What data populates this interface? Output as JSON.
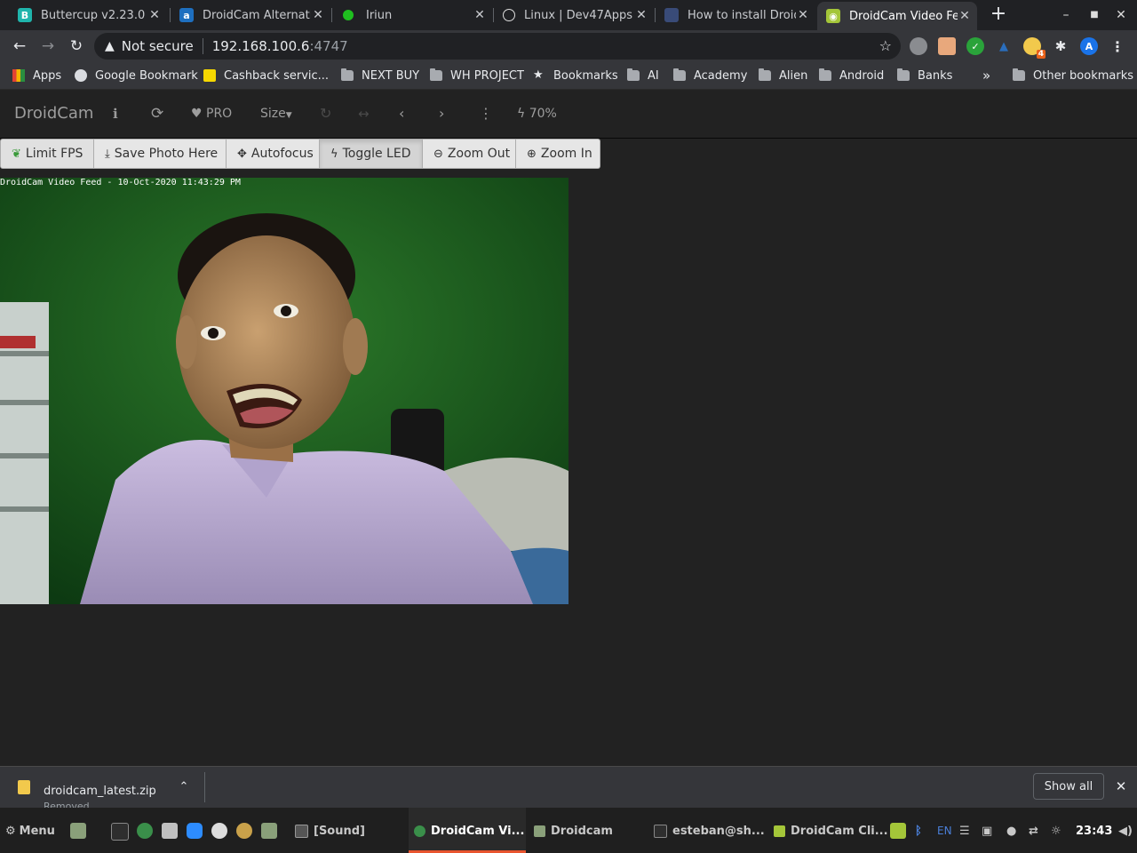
{
  "browser": {
    "tabs": [
      {
        "title": "Buttercup v2.23.0",
        "icon": "buttercup-icon",
        "color": "#1fb5ac"
      },
      {
        "title": "DroidCam Alternati",
        "icon": "alternativeto-icon",
        "color": "#1e6fbf"
      },
      {
        "title": "Iriun",
        "icon": "iriun-dot-icon",
        "color": "#1fbf1f"
      },
      {
        "title": "Linux | Dev47Apps",
        "icon": "dev47apps-icon",
        "color": "#dddddd"
      },
      {
        "title": "How to install Droid",
        "icon": "howto-icon",
        "color": "#394b78"
      },
      {
        "title": "DroidCam Video Fe",
        "icon": "droidcam-icon",
        "color": "#a4c639"
      }
    ],
    "new_tab": "+",
    "address": {
      "security": "Not secure",
      "host": "192.168.100.6",
      "port": ":4747"
    },
    "bookmarks": [
      {
        "label": "Apps",
        "icon": "apps-grid-icon"
      },
      {
        "label": "Google Bookmark",
        "icon": "globe-icon"
      },
      {
        "label": "Cashback servic...",
        "icon": "cashback-icon"
      },
      {
        "label": "NEXT BUY",
        "icon": "folder-icon"
      },
      {
        "label": "WH PROJECT",
        "icon": "folder-icon"
      },
      {
        "label": "Bookmarks",
        "icon": "star-icon"
      },
      {
        "label": "AI",
        "icon": "folder-icon"
      },
      {
        "label": "Academy",
        "icon": "folder-icon"
      },
      {
        "label": "Alien",
        "icon": "folder-icon"
      },
      {
        "label": "Android",
        "icon": "folder-icon"
      },
      {
        "label": "Banks",
        "icon": "folder-icon"
      }
    ],
    "bookmarks_overflow": "»",
    "other_bookmarks": "Other bookmarks",
    "profile_initial": "A",
    "extension_badge": "4"
  },
  "droidcam": {
    "brand": "DroidCam",
    "pro": "PRO",
    "size": "Size",
    "battery": "70%",
    "buttons": {
      "limit_fps": "Limit FPS",
      "save_photo": "Save Photo Here",
      "autofocus": "Autofocus",
      "toggle_led": "Toggle LED",
      "zoom_out": "Zoom Out",
      "zoom_in": "Zoom In"
    },
    "video_caption": "DroidCam Video Feed - 10-Oct-2020 11:43:29 PM"
  },
  "download": {
    "filename": "droidcam_latest.zip",
    "status": "Removed",
    "show_all": "Show all"
  },
  "taskbar": {
    "menu": "Menu",
    "windows": [
      {
        "label": "[Sound]"
      },
      {
        "label": "DroidCam Vi..."
      },
      {
        "label": "Droidcam"
      },
      {
        "label": "esteban@sh..."
      },
      {
        "label": "DroidCam Cli..."
      }
    ],
    "lang": "EN",
    "clock": "23:43"
  }
}
